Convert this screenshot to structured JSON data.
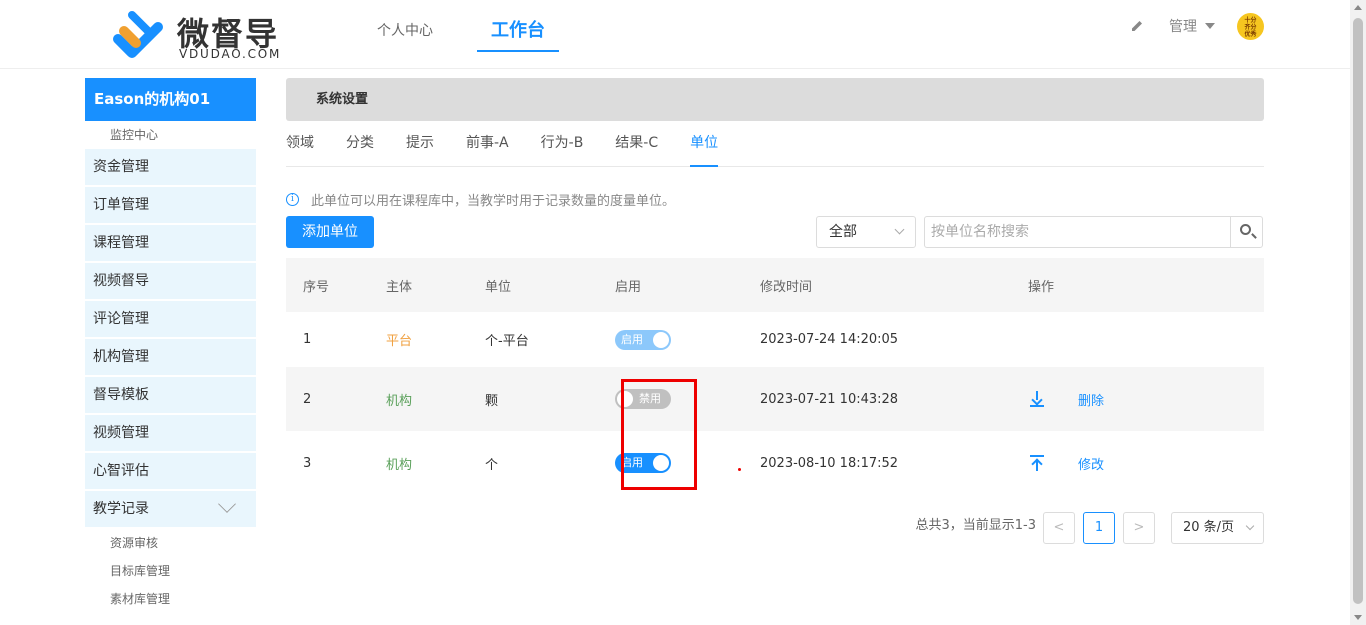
{
  "header": {
    "logo_title": "微督导",
    "logo_subtitle": "VDUDAO.COM",
    "nav": [
      "个人中心",
      "工作台"
    ],
    "admin_label": "管理",
    "avatar_text": "十分\n齐分\n优秀"
  },
  "sidebar": {
    "org_title": "Eason的机构01",
    "monitor_link": "监控中心",
    "menu": [
      "资金管理",
      "订单管理",
      "课程管理",
      "视频督导",
      "评论管理",
      "机构管理",
      "督导模板",
      "视频管理",
      "心智评估",
      "教学记录"
    ],
    "sub_links": [
      "资源审核",
      "目标库管理",
      "素材库管理"
    ]
  },
  "main": {
    "section_title": "系统设置",
    "tabs": [
      "领域",
      "分类",
      "提示",
      "前事-A",
      "行为-B",
      "结果-C",
      "单位"
    ],
    "active_tab": "单位",
    "info_text": "此单位可以用在课程库中，当教学时用于记录数量的度量单位。",
    "add_button": "添加单位",
    "filter_value": "全部",
    "search_placeholder": "按单位名称搜索",
    "table": {
      "headers": [
        "序号",
        "主体",
        "单位",
        "启用",
        "修改时间",
        "操作"
      ],
      "rows": [
        {
          "no": "1",
          "subject": "平台",
          "unit": "个-平台",
          "toggle": "启用",
          "time": "2023-07-24 14:20:05",
          "op": ""
        },
        {
          "no": "2",
          "subject": "机构",
          "unit": "颗",
          "toggle": "禁用",
          "time": "2023-07-21 10:43:28",
          "op": "删除"
        },
        {
          "no": "3",
          "subject": "机构",
          "unit": "个",
          "toggle": "启用",
          "time": "2023-08-10 18:17:52",
          "op": "修改"
        }
      ]
    },
    "pagination": {
      "total_text": "总共3，当前显示1-3",
      "prev": "<",
      "current_page": "1",
      "next": ">",
      "page_size": "20 条/页"
    }
  },
  "colors": {
    "accent": "#1890ff",
    "sidebar_bg": "#e9f6fd",
    "platform": "#f0a040",
    "org": "#5aa05a",
    "highlight": "#e00000"
  }
}
